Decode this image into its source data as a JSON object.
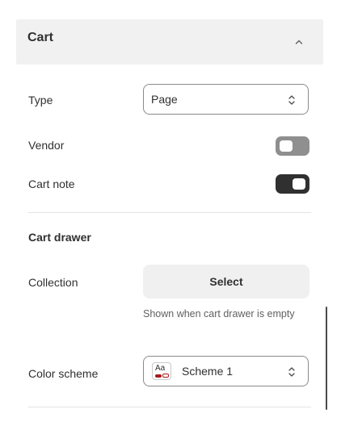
{
  "header": {
    "title": "Cart",
    "icon": "chevron-up-icon"
  },
  "settings": {
    "type_label": "Type",
    "type_value": "Page",
    "vendor_label": "Vendor",
    "vendor_enabled": false,
    "cart_note_label": "Cart note",
    "cart_note_enabled": true
  },
  "cart_drawer": {
    "title": "Cart drawer",
    "collection_label": "Collection",
    "collection_button": "Select",
    "collection_help": "Shown when cart drawer is empty",
    "color_scheme_label": "Color scheme",
    "color_scheme_swatch_text": "Aa",
    "color_scheme_value": "Scheme 1",
    "swatch_accent": "#a61b1b"
  },
  "colors": {
    "header_bg": "#f1f1f1",
    "toggle_on": "#303030",
    "toggle_off": "#8f8f8f"
  }
}
